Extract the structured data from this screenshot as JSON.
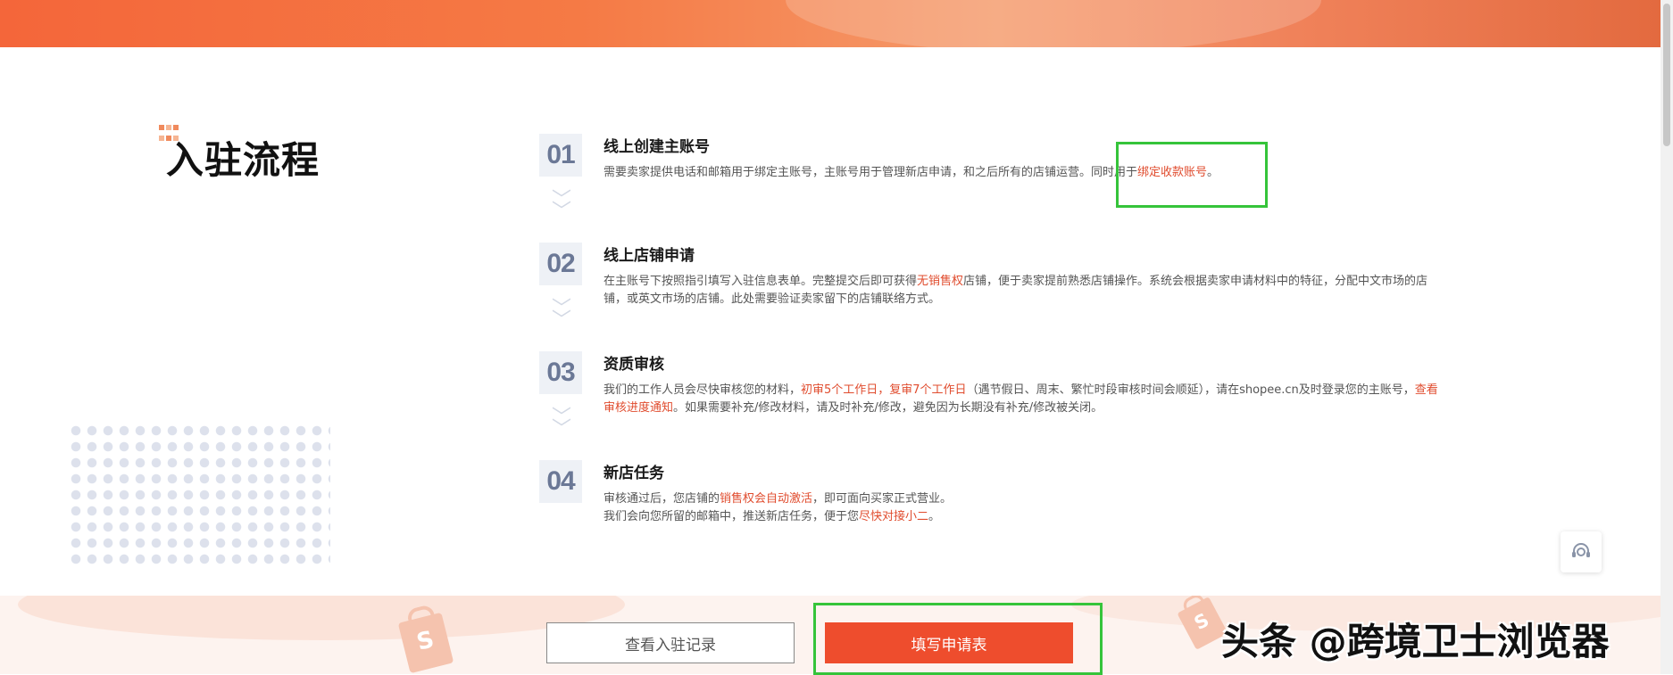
{
  "section": {
    "title": "入驻流程"
  },
  "steps": [
    {
      "num": "01",
      "title": "线上创建主账号",
      "desc_parts": [
        "需要卖家提供电话和邮箱用于绑定主账号，主账号用于管理新店申请，和之后所有的店铺运营。同时用于",
        "绑定收款账号",
        "。"
      ]
    },
    {
      "num": "02",
      "title": "线上店铺申请",
      "desc_parts": [
        "在主账号下按照指引填写入驻信息表单。完整提交后即可获得",
        "无销售权",
        "店铺，便于卖家提前熟悉店铺操作。系统会根据卖家申请材料中的特征，分配中文市场的店铺，或英文市场的店铺。此处需要验证卖家留下的店铺联络方式。"
      ]
    },
    {
      "num": "03",
      "title": "资质审核",
      "desc_parts": [
        "我们的工作人员会尽快审核您的材料，",
        "初审5个工作日，复审7个工作日",
        "（遇节假日、周末、繁忙时段审核时间会顺延），请在shopee.cn及时登录您的主账号，",
        "查看审核进度通知",
        "。如果需要补充/修改材料，请及时补充/修改，避免因为长期没有补充/修改被关闭。"
      ]
    },
    {
      "num": "04",
      "title": "新店任务",
      "desc_parts": [
        "审核通过后，您店铺的",
        "销售权会自动激活",
        "，即可面向买家正式营业。",
        "我们会向您所留的邮箱中，推送新店任务，便于您",
        "尽快对接小二",
        "。"
      ]
    }
  ],
  "buttons": {
    "records": "查看入驻记录",
    "apply": "填写申请表"
  },
  "bag_letter": "S",
  "watermark": "头条 @跨境卫士浏览器",
  "colors": {
    "accent": "#ee4d2d",
    "highlight_box": "#35c43a"
  }
}
